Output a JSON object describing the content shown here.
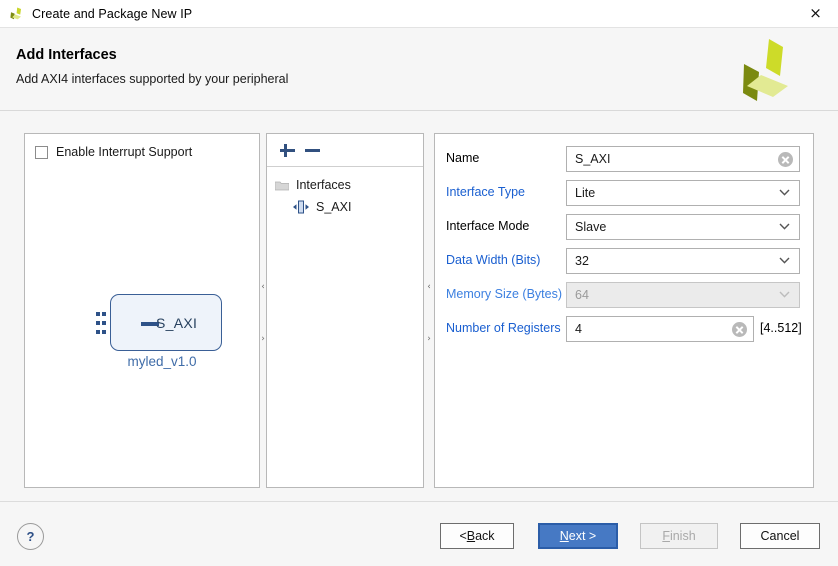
{
  "window": {
    "title": "Create and Package New IP",
    "app_icon": "xilinx-logo-icon",
    "close_label": "×"
  },
  "header": {
    "title": "Add Interfaces",
    "subtitle": "Add AXI4 interfaces supported by your peripheral",
    "brand_icon": "xilinx-logo"
  },
  "left_panel": {
    "interrupt_checkbox": {
      "label": "Enable Interrupt Support",
      "checked": false
    },
    "diagram": {
      "block_port_label": "S_AXI",
      "block_name": "myled_v1.0"
    }
  },
  "middle_panel": {
    "toolbar": {
      "add_label": "+",
      "remove_label": "−"
    },
    "tree": [
      {
        "label": "Interfaces",
        "icon": "folder-icon",
        "level": 0
      },
      {
        "label": "S_AXI",
        "icon": "bus-interface-icon",
        "level": 1
      }
    ]
  },
  "right_panel": {
    "fields": [
      {
        "label": "Name",
        "value": "S_AXI",
        "type": "text",
        "label_color": "black",
        "enabled": true,
        "clearable": true
      },
      {
        "label": "Interface Type",
        "value": "Lite",
        "type": "select",
        "label_color": "blue",
        "enabled": true,
        "clearable": false
      },
      {
        "label": "Interface Mode",
        "value": "Slave",
        "type": "select",
        "label_color": "black",
        "enabled": true,
        "clearable": false
      },
      {
        "label": "Data Width (Bits)",
        "value": "32",
        "type": "select",
        "label_color": "blue",
        "enabled": true,
        "clearable": false
      },
      {
        "label": "Memory Size (Bytes)",
        "value": "64",
        "type": "select",
        "label_color": "blue",
        "enabled": false,
        "clearable": false
      },
      {
        "label": "Number of Registers",
        "value": "4",
        "type": "text",
        "label_color": "blue",
        "enabled": true,
        "clearable": true,
        "range_hint": "[4..512]"
      }
    ]
  },
  "footer": {
    "help_label": "?",
    "buttons": {
      "back": {
        "pre": "< ",
        "mnemonic": "B",
        "post": "ack"
      },
      "next": {
        "pre": "",
        "mnemonic": "N",
        "post": "ext >"
      },
      "finish": {
        "pre": "",
        "mnemonic": "F",
        "post": "inish"
      },
      "cancel": {
        "pre": "Cancel",
        "mnemonic": "",
        "post": ""
      }
    }
  },
  "colors": {
    "accent_blue": "#4679c4",
    "link_blue": "#1a5fd0",
    "brand_green": "#cddb29",
    "brand_olive": "#7b8a10"
  }
}
